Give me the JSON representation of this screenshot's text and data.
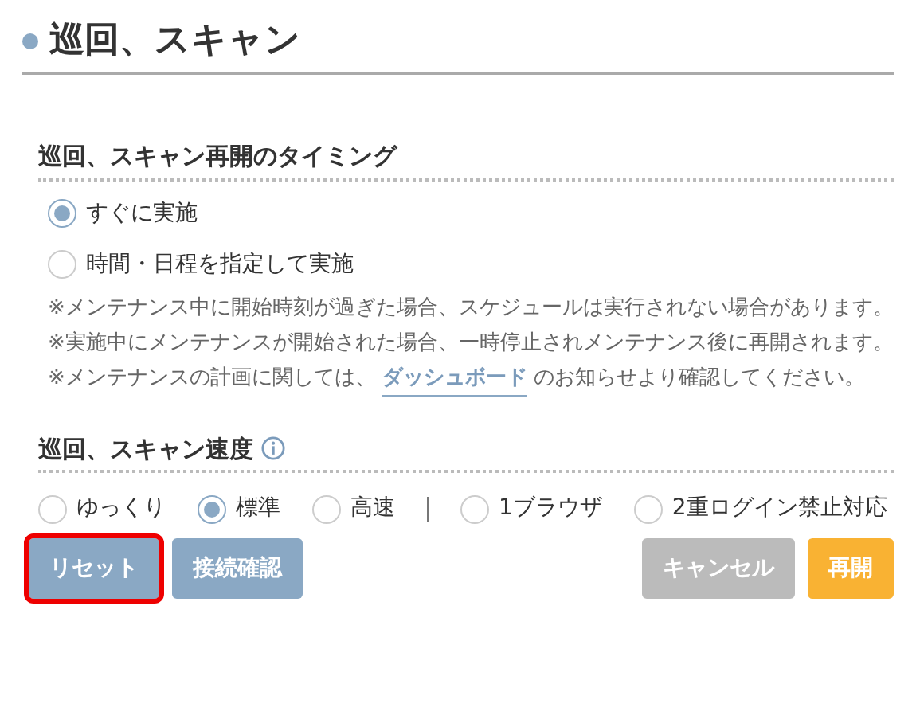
{
  "title": "巡回、スキャン",
  "timing": {
    "heading": "巡回、スキャン再開のタイミング",
    "options": [
      {
        "label": "すぐに実施",
        "selected": true
      },
      {
        "label": "時間・日程を指定して実施",
        "selected": false
      }
    ],
    "notes": [
      {
        "text": "※メンテナンス中に開始時刻が過ぎた場合、スケジュールは実行されない場合があります。"
      },
      {
        "text": "※実施中にメンテナンスが開始された場合、一時停止されメンテナンス後に再開されます。"
      },
      {
        "text": "※メンテナンスの計画に関しては、",
        "link": "ダッシュボード",
        "after": "のお知らせより確認してください。"
      }
    ]
  },
  "speed": {
    "heading": "巡回、スキャン速度",
    "options": [
      {
        "label": "ゆっくり",
        "selected": false
      },
      {
        "label": "標準",
        "selected": true
      },
      {
        "label": "高速",
        "selected": false
      }
    ],
    "browser_options": [
      {
        "label": "1ブラウザ",
        "selected": false
      },
      {
        "label": "2重ログイン禁止対応",
        "selected": false
      }
    ]
  },
  "buttons_left": [
    {
      "label": "リセット",
      "kind": "primary",
      "highlighted": true
    },
    {
      "label": "接続確認",
      "kind": "primary",
      "highlighted": false
    }
  ],
  "buttons_right": [
    {
      "label": "キャンセル",
      "kind": "neutral",
      "highlighted": false
    },
    {
      "label": "再開",
      "kind": "accent",
      "highlighted": false
    }
  ]
}
